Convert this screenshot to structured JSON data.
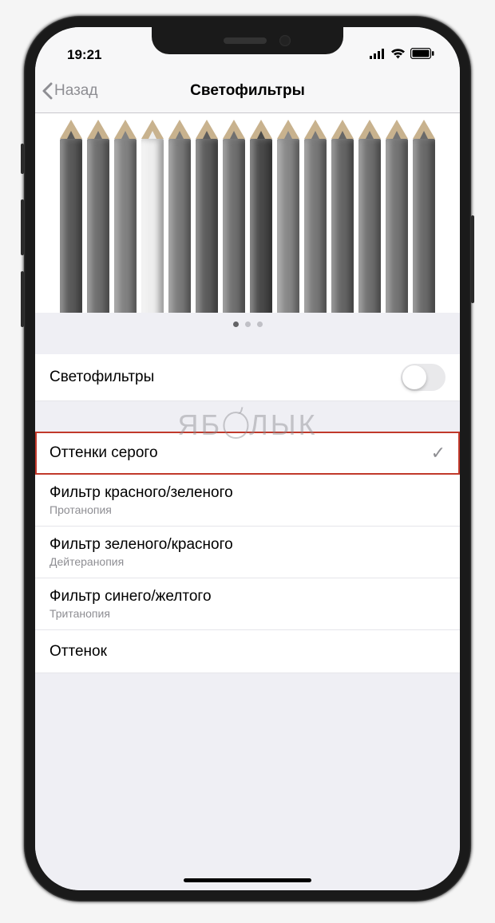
{
  "status": {
    "time": "19:21"
  },
  "nav": {
    "back_label": "Назад",
    "title": "Светофильтры"
  },
  "pencil_shades": [
    "#5a5a5a",
    "#6e6e6e",
    "#828282",
    "#eeeeee",
    "#7a7a7a",
    "#5c5c5c",
    "#707070",
    "#4a4a4a",
    "#888888",
    "#787878",
    "#666666",
    "#707070",
    "#747474",
    "#6a6a6a"
  ],
  "pager": {
    "count": 3,
    "active": 0
  },
  "toggle_row": {
    "label": "Светофильтры",
    "on": false
  },
  "watermark_left": "ЯБ",
  "watermark_right": "ЛЫК",
  "filters": [
    {
      "label": "Оттенки серого",
      "sub": "",
      "selected": true,
      "highlighted": true
    },
    {
      "label": "Фильтр красного/зеленого",
      "sub": "Протанопия",
      "selected": false,
      "highlighted": false
    },
    {
      "label": "Фильтр зеленого/красного",
      "sub": "Дейтеранопия",
      "selected": false,
      "highlighted": false
    },
    {
      "label": "Фильтр синего/желтого",
      "sub": "Тританопия",
      "selected": false,
      "highlighted": false
    },
    {
      "label": "Оттенок",
      "sub": "",
      "selected": false,
      "highlighted": false
    }
  ]
}
